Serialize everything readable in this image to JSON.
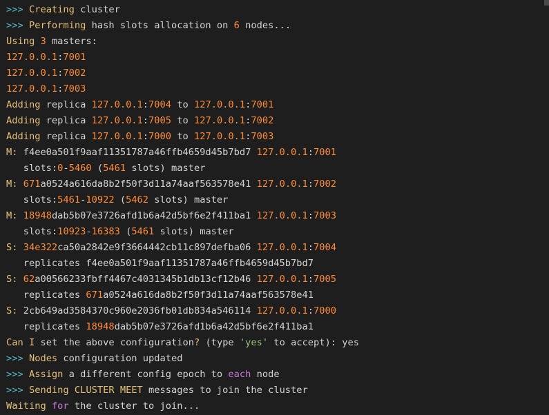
{
  "colors": {
    "background": "#1e1e1e",
    "text": "#d4d4d4",
    "prompt": "#56b6c2",
    "keyword": "#e5c07b",
    "number": "#ff8c3b",
    "string": "#98c379",
    "purple": "#c678dd"
  },
  "terminal": {
    "lines": [
      [
        {
          "t": ">>> ",
          "c": "prompt"
        },
        {
          "t": "Creating",
          "c": "keyword"
        },
        {
          "t": " cluster"
        }
      ],
      [
        {
          "t": ">>> ",
          "c": "prompt"
        },
        {
          "t": "Performing",
          "c": "keyword"
        },
        {
          "t": " hash slots allocation on "
        },
        {
          "t": "6",
          "c": "number"
        },
        {
          "t": " nodes..."
        }
      ],
      [
        {
          "t": "Using",
          "c": "keyword"
        },
        {
          "t": " "
        },
        {
          "t": "3",
          "c": "number"
        },
        {
          "t": " masters:"
        }
      ],
      [
        {
          "t": "127.0.0.1",
          "c": "number"
        },
        {
          "t": ":"
        },
        {
          "t": "7001",
          "c": "number"
        }
      ],
      [
        {
          "t": "127.0.0.1",
          "c": "number"
        },
        {
          "t": ":"
        },
        {
          "t": "7002",
          "c": "number"
        }
      ],
      [
        {
          "t": "127.0.0.1",
          "c": "number"
        },
        {
          "t": ":"
        },
        {
          "t": "7003",
          "c": "number"
        }
      ],
      [
        {
          "t": "Adding",
          "c": "keyword"
        },
        {
          "t": " replica "
        },
        {
          "t": "127.0.0.1",
          "c": "number"
        },
        {
          "t": ":"
        },
        {
          "t": "7004",
          "c": "number"
        },
        {
          "t": " to "
        },
        {
          "t": "127.0.0.1",
          "c": "number"
        },
        {
          "t": ":"
        },
        {
          "t": "7001",
          "c": "number"
        }
      ],
      [
        {
          "t": "Adding",
          "c": "keyword"
        },
        {
          "t": " replica "
        },
        {
          "t": "127.0.0.1",
          "c": "number"
        },
        {
          "t": ":"
        },
        {
          "t": "7005",
          "c": "number"
        },
        {
          "t": " to "
        },
        {
          "t": "127.0.0.1",
          "c": "number"
        },
        {
          "t": ":"
        },
        {
          "t": "7002",
          "c": "number"
        }
      ],
      [
        {
          "t": "Adding",
          "c": "keyword"
        },
        {
          "t": " replica "
        },
        {
          "t": "127.0.0.1",
          "c": "number"
        },
        {
          "t": ":"
        },
        {
          "t": "7000",
          "c": "number"
        },
        {
          "t": " to "
        },
        {
          "t": "127.0.0.1",
          "c": "number"
        },
        {
          "t": ":"
        },
        {
          "t": "7003",
          "c": "number"
        }
      ],
      [
        {
          "t": "M:",
          "c": "keyword"
        },
        {
          "t": " f4ee0a501f9aaf11351787a46ffb4659d45b7bd7 "
        },
        {
          "t": "127.0.0.1",
          "c": "number"
        },
        {
          "t": ":"
        },
        {
          "t": "7001",
          "c": "number"
        }
      ],
      [
        {
          "t": "   slots:"
        },
        {
          "t": "0",
          "c": "number"
        },
        {
          "t": "-"
        },
        {
          "t": "5460",
          "c": "number"
        },
        {
          "t": " ("
        },
        {
          "t": "5461",
          "c": "number"
        },
        {
          "t": " slots) master"
        }
      ],
      [
        {
          "t": "M:",
          "c": "keyword"
        },
        {
          "t": " "
        },
        {
          "t": "671",
          "c": "number"
        },
        {
          "t": "a0524a616da8b2f50f3d11a74aaf563578e41 "
        },
        {
          "t": "127.0.0.1",
          "c": "number"
        },
        {
          "t": ":"
        },
        {
          "t": "7002",
          "c": "number"
        }
      ],
      [
        {
          "t": "   slots:"
        },
        {
          "t": "5461",
          "c": "number"
        },
        {
          "t": "-"
        },
        {
          "t": "10922",
          "c": "number"
        },
        {
          "t": " ("
        },
        {
          "t": "5462",
          "c": "number"
        },
        {
          "t": " slots) master"
        }
      ],
      [
        {
          "t": "M:",
          "c": "keyword"
        },
        {
          "t": " "
        },
        {
          "t": "18948",
          "c": "number"
        },
        {
          "t": "dab5b07e3726afd1b6a42d5bf6e2f411ba1 "
        },
        {
          "t": "127.0.0.1",
          "c": "number"
        },
        {
          "t": ":"
        },
        {
          "t": "7003",
          "c": "number"
        }
      ],
      [
        {
          "t": "   slots:"
        },
        {
          "t": "10923",
          "c": "number"
        },
        {
          "t": "-"
        },
        {
          "t": "16383",
          "c": "number"
        },
        {
          "t": " ("
        },
        {
          "t": "5461",
          "c": "number"
        },
        {
          "t": " slots) master"
        }
      ],
      [
        {
          "t": "S:",
          "c": "keyword"
        },
        {
          "t": " "
        },
        {
          "t": "34e322",
          "c": "number"
        },
        {
          "t": "ca50a2842e9f3664442cb11c897defba06 "
        },
        {
          "t": "127.0.0.1",
          "c": "number"
        },
        {
          "t": ":"
        },
        {
          "t": "7004",
          "c": "number"
        }
      ],
      [
        {
          "t": "   replicates f4ee0a501f9aaf11351787a46ffb4659d45b7bd7"
        }
      ],
      [
        {
          "t": "S:",
          "c": "keyword"
        },
        {
          "t": " "
        },
        {
          "t": "62",
          "c": "number"
        },
        {
          "t": "a00566233fbff4467c4031345b1db13cf12b46 "
        },
        {
          "t": "127.0.0.1",
          "c": "number"
        },
        {
          "t": ":"
        },
        {
          "t": "7005",
          "c": "number"
        }
      ],
      [
        {
          "t": "   replicates "
        },
        {
          "t": "671",
          "c": "number"
        },
        {
          "t": "a0524a616da8b2f50f3d11a74aaf563578e41"
        }
      ],
      [
        {
          "t": "S:",
          "c": "keyword"
        },
        {
          "t": " 2cb649ad3584370c960e2036fb01db834a546114 "
        },
        {
          "t": "127.0.0.1",
          "c": "number"
        },
        {
          "t": ":"
        },
        {
          "t": "7000",
          "c": "number"
        }
      ],
      [
        {
          "t": "   replicates "
        },
        {
          "t": "18948",
          "c": "number"
        },
        {
          "t": "dab5b07e3726afd1b6a42d5bf6e2f411ba1"
        }
      ],
      [
        {
          "t": "Can",
          "c": "keyword"
        },
        {
          "t": " "
        },
        {
          "t": "I",
          "c": "keyword"
        },
        {
          "t": " set the above configuration"
        },
        {
          "t": "?",
          "c": "keyword"
        },
        {
          "t": " (type "
        },
        {
          "t": "'yes'",
          "c": "string"
        },
        {
          "t": " to accept): yes"
        }
      ],
      [
        {
          "t": ">>> ",
          "c": "prompt"
        },
        {
          "t": "Nodes",
          "c": "keyword"
        },
        {
          "t": " configuration updated"
        }
      ],
      [
        {
          "t": ">>> ",
          "c": "prompt"
        },
        {
          "t": "Assign",
          "c": "keyword"
        },
        {
          "t": " a different config epoch to "
        },
        {
          "t": "each",
          "c": "purple"
        },
        {
          "t": " node"
        }
      ],
      [
        {
          "t": ">>> ",
          "c": "prompt"
        },
        {
          "t": "Sending",
          "c": "keyword"
        },
        {
          "t": " "
        },
        {
          "t": "CLUSTER MEET",
          "c": "keyword"
        },
        {
          "t": " messages to join the cluster"
        }
      ],
      [
        {
          "t": "Waiting",
          "c": "keyword"
        },
        {
          "t": " "
        },
        {
          "t": "for",
          "c": "purple"
        },
        {
          "t": " the cluster to join..."
        }
      ]
    ]
  }
}
